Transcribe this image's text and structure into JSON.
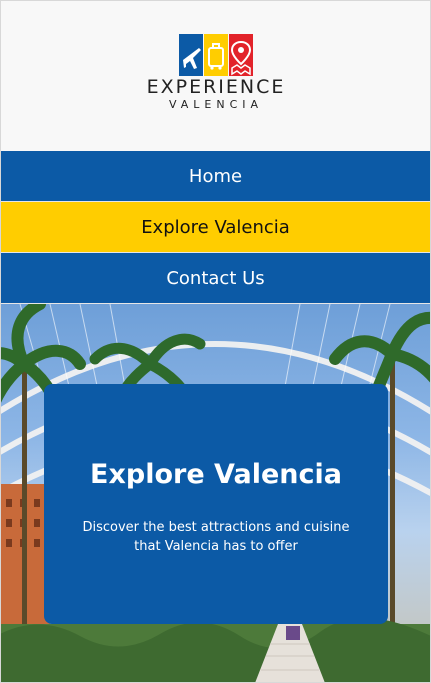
{
  "logo": {
    "word": "EXPERIENCE",
    "sub": "VALENCIA",
    "colors": {
      "blue": "#0c5aa6",
      "yellow": "#ffcd00",
      "red": "#e2232a"
    }
  },
  "nav": {
    "items": [
      {
        "label": "Home",
        "active": false
      },
      {
        "label": "Explore Valencia",
        "active": true
      },
      {
        "label": "Contact Us",
        "active": false
      }
    ]
  },
  "hero": {
    "title": "Explore Valencia",
    "text": "Discover the best attractions and cuisine that Valencia has to offer"
  },
  "colors": {
    "primary": "#0c5aa6",
    "accent": "#ffcd00",
    "text_on_accent": "#111111"
  }
}
